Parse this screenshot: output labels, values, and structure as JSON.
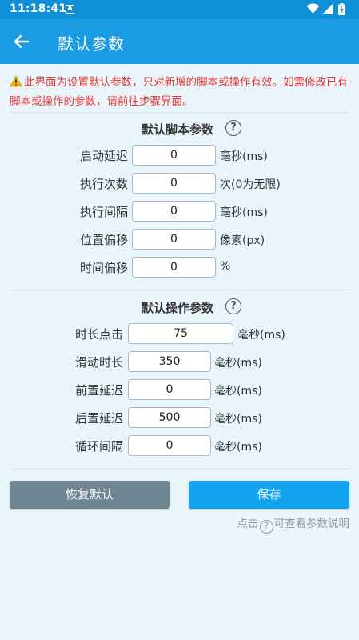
{
  "status": {
    "time": "11:18:41",
    "app_icon": "A"
  },
  "header": {
    "title": "默认参数"
  },
  "warning": {
    "text": "此界面为设置默认参数，只对新增的脚本或操作有效。如需修改已有脚本或操作的参数，请前往步骤界面。"
  },
  "script_section": {
    "title": "默认脚本参数",
    "rows": [
      {
        "label": "启动延迟",
        "value": "0",
        "unit": "毫秒(ms)"
      },
      {
        "label": "执行次数",
        "value": "0",
        "unit": "次(0为无限)"
      },
      {
        "label": "执行间隔",
        "value": "0",
        "unit": "毫秒(ms)"
      },
      {
        "label": "位置偏移",
        "value": "0",
        "unit": "像素(px)"
      },
      {
        "label": "时间偏移",
        "value": "0",
        "unit": "%"
      }
    ]
  },
  "action_section": {
    "title": "默认操作参数",
    "rows": [
      {
        "label": "时长点击",
        "value": "75",
        "unit": "毫秒(ms)"
      },
      {
        "label": "滑动时长",
        "value": "350",
        "unit": "毫秒(ms)"
      },
      {
        "label": "前置延迟",
        "value": "0",
        "unit": "毫秒(ms)"
      },
      {
        "label": "后置延迟",
        "value": "500",
        "unit": "毫秒(ms)"
      },
      {
        "label": "循环间隔",
        "value": "0",
        "unit": "毫秒(ms)"
      }
    ]
  },
  "buttons": {
    "reset": "恢复默认",
    "save": "保存"
  },
  "footer": {
    "hint_before": "点击",
    "hint_icon": "?",
    "hint_after": "可查看参数说明"
  },
  "colors": {
    "status_bar": "#0e8fd6",
    "app_bar": "#1a9be4",
    "warning": "#e53935",
    "save_button": "#14a3f0",
    "reset_button": "#6f8592",
    "background": "#e9f4fb"
  },
  "icons": {
    "back": "arrow-left-icon",
    "help": "question-circle-icon",
    "warning": "warning-triangle-icon"
  }
}
